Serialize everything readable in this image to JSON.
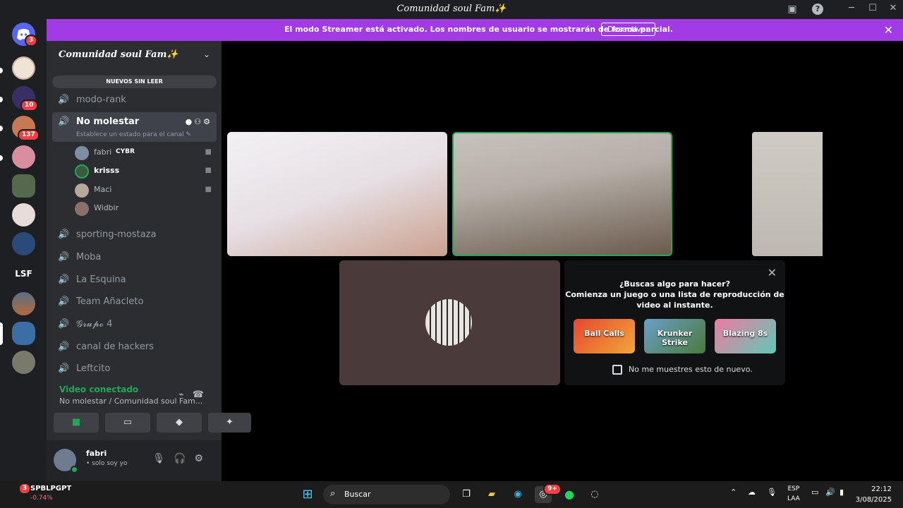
{
  "window": {
    "title": "Comunidad soul Fam✨"
  },
  "guilds": {
    "home_badge": "3",
    "badges": [
      "10",
      "137"
    ],
    "lsf_label": "LSF"
  },
  "banner": {
    "text": "El modo Streamer está activado. Los nombres de usuario se mostrarán de forma parcial.",
    "button": "Desactivar"
  },
  "sidebar": {
    "server_name": "Comunidad soul Fam✨",
    "unread_label": "NUEVOS SIN LEER",
    "channels": [
      {
        "name": "modo-rank"
      },
      {
        "name": "No molestar",
        "status": "Establece un estado para el canal ✎"
      },
      {
        "name": "sporting-mostaza"
      },
      {
        "name": "Moba"
      },
      {
        "name": "La Esquina"
      },
      {
        "name": "Team Añacleto"
      },
      {
        "name": "𝓖𝓻𝓾𝓹𝓸 4"
      },
      {
        "name": "canal de hackers"
      },
      {
        "name": "Leftcito"
      }
    ],
    "members": [
      {
        "name": "fabri",
        "tag": "CYBR"
      },
      {
        "name": "krisss"
      },
      {
        "name": "Maci"
      },
      {
        "name": "Widbir"
      }
    ]
  },
  "voice": {
    "title": "Video conectado",
    "subtitle": "No molestar / Comunidad soul Fam..."
  },
  "user": {
    "name": "fabri",
    "status": "• solo soy yo"
  },
  "suggest": {
    "line1": "¿Buscas algo para hacer?",
    "line2": "Comienza un juego o una lista de reproducción de",
    "line3": "video al instante.",
    "games": [
      "Ball Calls",
      "Krunker Strike",
      "Blazing 8s"
    ],
    "checkbox": "No me muestres esto de nuevo."
  },
  "taskbar": {
    "stock_name": "SPBLPGPT",
    "stock_change": "-0.74%",
    "stock_badge": "3",
    "search": "Buscar",
    "lang1": "ESP",
    "lang2": "LAA",
    "time": "22:12",
    "date": "3/08/2025",
    "discord_badge": "9+"
  }
}
